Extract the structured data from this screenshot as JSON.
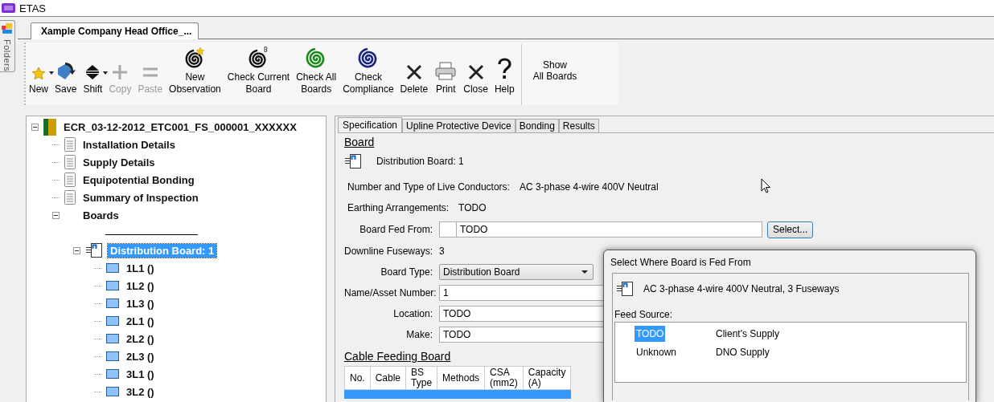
{
  "window": {
    "title": "ETAS"
  },
  "side_panel": {
    "label": "Folders"
  },
  "document_tab": {
    "label": "Xample Company Head Office_...",
    "selected": true
  },
  "toolbar": {
    "buttons": [
      {
        "label": "New",
        "disabled": false,
        "has_menu": true
      },
      {
        "label": "Save",
        "disabled": false,
        "has_menu": false
      },
      {
        "label": "Shift",
        "disabled": false,
        "has_menu": true
      },
      {
        "label": "Copy",
        "disabled": true,
        "has_menu": false
      },
      {
        "label": "Paste",
        "disabled": true,
        "has_menu": false
      },
      {
        "label": "New\nObservation",
        "disabled": false,
        "has_menu": false
      },
      {
        "label": "Check Current\nBoard",
        "disabled": false,
        "has_menu": false
      },
      {
        "label": "Check All\nBoards",
        "disabled": false,
        "has_menu": false
      },
      {
        "label": "Check\nCompliance",
        "disabled": false,
        "has_menu": false
      },
      {
        "label": "Delete",
        "disabled": false,
        "has_menu": false
      },
      {
        "label": "Print",
        "disabled": false,
        "has_menu": false
      },
      {
        "label": "Close",
        "disabled": false,
        "has_menu": false
      },
      {
        "label": "Help",
        "disabled": false,
        "has_menu": false
      }
    ],
    "show_all": {
      "label": "Show\nAll Boards"
    }
  },
  "tree": {
    "kind": "root",
    "label": "ECR_03-12-2012_ETC001_FS_000001_XXXXXX",
    "selected": false,
    "expanded": true,
    "children": [
      {
        "kind": "page",
        "label": "Installation Details",
        "selected": false
      },
      {
        "kind": "page",
        "label": "Supply Details",
        "selected": false
      },
      {
        "kind": "page",
        "label": "Equipotential Bonding",
        "selected": false
      },
      {
        "kind": "page",
        "label": "Summary of Inspection",
        "selected": false
      },
      {
        "kind": "group",
        "label": "Boards",
        "selected": false,
        "expanded": true,
        "children": [
          {
            "kind": "separator"
          },
          {
            "kind": "board",
            "label": "Distribution Board: 1",
            "selected": true,
            "expanded": true,
            "children": [
              {
                "kind": "circuit",
                "label": "1L1 ()",
                "selected": false
              },
              {
                "kind": "circuit",
                "label": "1L2 ()",
                "selected": false
              },
              {
                "kind": "circuit",
                "label": "1L3 ()",
                "selected": false
              },
              {
                "kind": "circuit",
                "label": "2L1 ()",
                "selected": false
              },
              {
                "kind": "circuit",
                "label": "2L2 ()",
                "selected": false
              },
              {
                "kind": "circuit",
                "label": "2L3 ()",
                "selected": false
              },
              {
                "kind": "circuit",
                "label": "3L1 ()",
                "selected": false
              },
              {
                "kind": "circuit",
                "label": "3L2 ()",
                "selected": false
              }
            ]
          }
        ]
      }
    ]
  },
  "tabs": [
    {
      "label": "Specification",
      "selected": true
    },
    {
      "label": "Upline Protective Device",
      "selected": false
    },
    {
      "label": "Bonding",
      "selected": false
    },
    {
      "label": "Results",
      "selected": false
    }
  ],
  "board_section": {
    "title": "Board",
    "board_name": "Distribution Board: 1",
    "fields": [
      {
        "kind": "wide",
        "label": "Number and Type of Live Conductors:",
        "value": "AC 3-phase 4-wire 400V Neutral"
      },
      {
        "kind": "wide",
        "label": "Earthing Arrangements:",
        "value": "TODO"
      },
      {
        "kind": "picker",
        "label": "Board Fed From:",
        "value": "TODO",
        "button": "Select..."
      },
      {
        "kind": "static",
        "label": "Downline Fuseways:",
        "value": "3"
      },
      {
        "kind": "dropdown",
        "label": "Board Type:",
        "value": "Distribution Board"
      },
      {
        "kind": "input",
        "label": "Name/Asset Number:",
        "value": "1"
      },
      {
        "kind": "input",
        "label": "Location:",
        "value": "TODO"
      },
      {
        "kind": "input",
        "label": "Make:",
        "value": "TODO"
      }
    ]
  },
  "cable_section": {
    "title": "Cable Feeding Board",
    "columns": [
      "No.",
      "Cable",
      "BS\nType",
      "Methods",
      "CSA\n(mm2)",
      "Capacity\n(A)"
    ],
    "rows": [
      {
        "selected": true
      }
    ]
  },
  "dialog": {
    "title": "Select Where Board is Fed From",
    "summary": "AC 3-phase 4-wire 400V Neutral, 3 Fuseways",
    "list_label": "Feed Source:",
    "items": [
      {
        "name": "TODO",
        "description": "Client's Supply",
        "selected": true
      },
      {
        "name": "Unknown",
        "description": "DNO Supply",
        "selected": false
      }
    ]
  }
}
